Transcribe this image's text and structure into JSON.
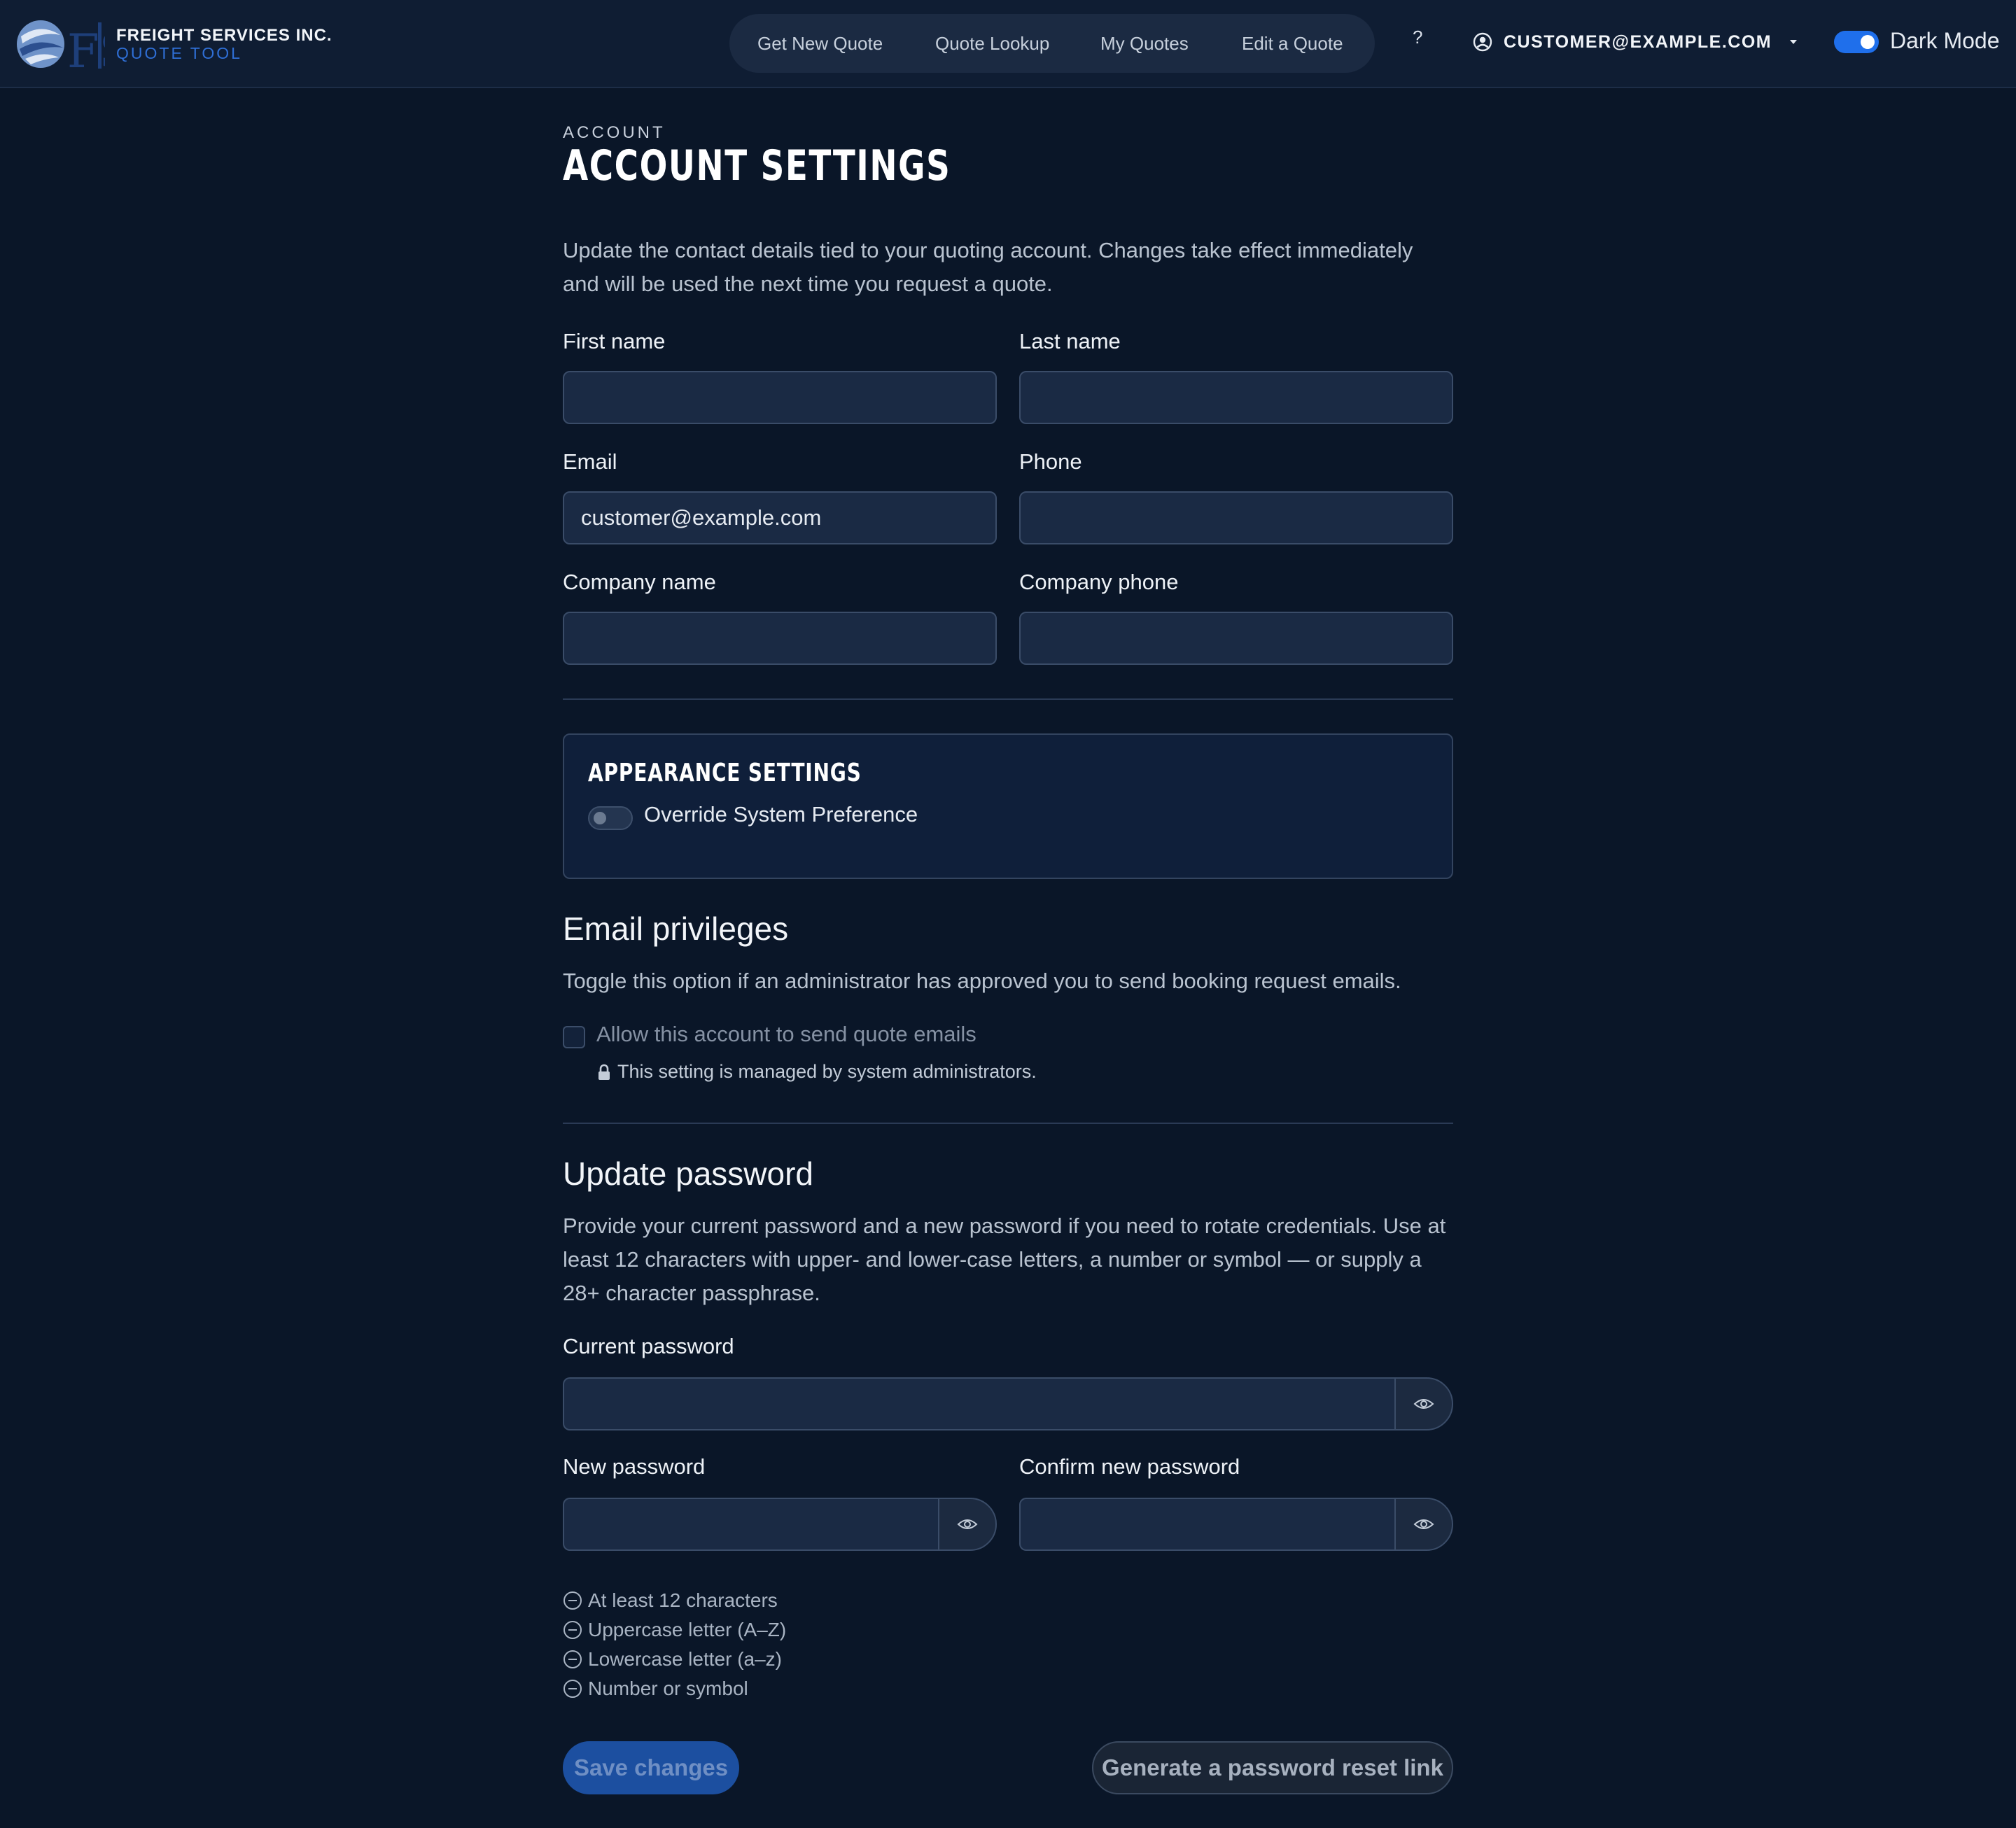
{
  "header": {
    "brand_name": "FREIGHT SERVICES INC.",
    "brand_sub": "QUOTE TOOL",
    "nav": [
      {
        "label": "Get New Quote"
      },
      {
        "label": "Quote Lookup"
      },
      {
        "label": "My Quotes"
      },
      {
        "label": "Edit a Quote"
      }
    ],
    "help_label": "?",
    "user_email": "CUSTOMER@EXAMPLE.COM",
    "dark_mode_label": "Dark Mode",
    "dark_mode_on": true
  },
  "page": {
    "eyebrow": "ACCOUNT",
    "title": "ACCOUNT SETTINGS",
    "intro": "Update the contact details tied to your quoting account. Changes take effect immediately and will be used the next time you request a quote."
  },
  "contact": {
    "first_name": {
      "label": "First name",
      "value": ""
    },
    "last_name": {
      "label": "Last name",
      "value": ""
    },
    "email": {
      "label": "Email",
      "value": "customer@example.com"
    },
    "phone": {
      "label": "Phone",
      "value": ""
    },
    "company_name": {
      "label": "Company name",
      "value": ""
    },
    "company_phone": {
      "label": "Company phone",
      "value": ""
    }
  },
  "appearance": {
    "title": "APPEARANCE SETTINGS",
    "override_label": "Override System Preference",
    "override_on": false
  },
  "email_privileges": {
    "heading": "Email privileges",
    "text": "Toggle this option if an administrator has approved you to send booking request emails.",
    "checkbox_label": "Allow this account to send quote emails",
    "checked": false,
    "managed_note": "This setting is managed by system administrators."
  },
  "password": {
    "heading": "Update password",
    "text": "Provide your current password and a new password if you need to rotate credentials. Use at least 12 characters with upper- and lower-case letters, a number or symbol — or supply a 28+ character passphrase.",
    "current_label": "Current password",
    "new_label": "New password",
    "confirm_label": "Confirm new password",
    "requirements": [
      {
        "text": "At least 12 characters"
      },
      {
        "text": "Uppercase letter (A–Z)"
      },
      {
        "text": "Lowercase letter (a–z)"
      },
      {
        "text": "Number or symbol"
      }
    ]
  },
  "actions": {
    "save_label": "Save changes",
    "reset_label": "Generate a password reset link"
  },
  "colors": {
    "background": "#0a1628",
    "header": "#0f1d33",
    "accent": "#1f6feb",
    "input_bg": "#1a2a44"
  }
}
